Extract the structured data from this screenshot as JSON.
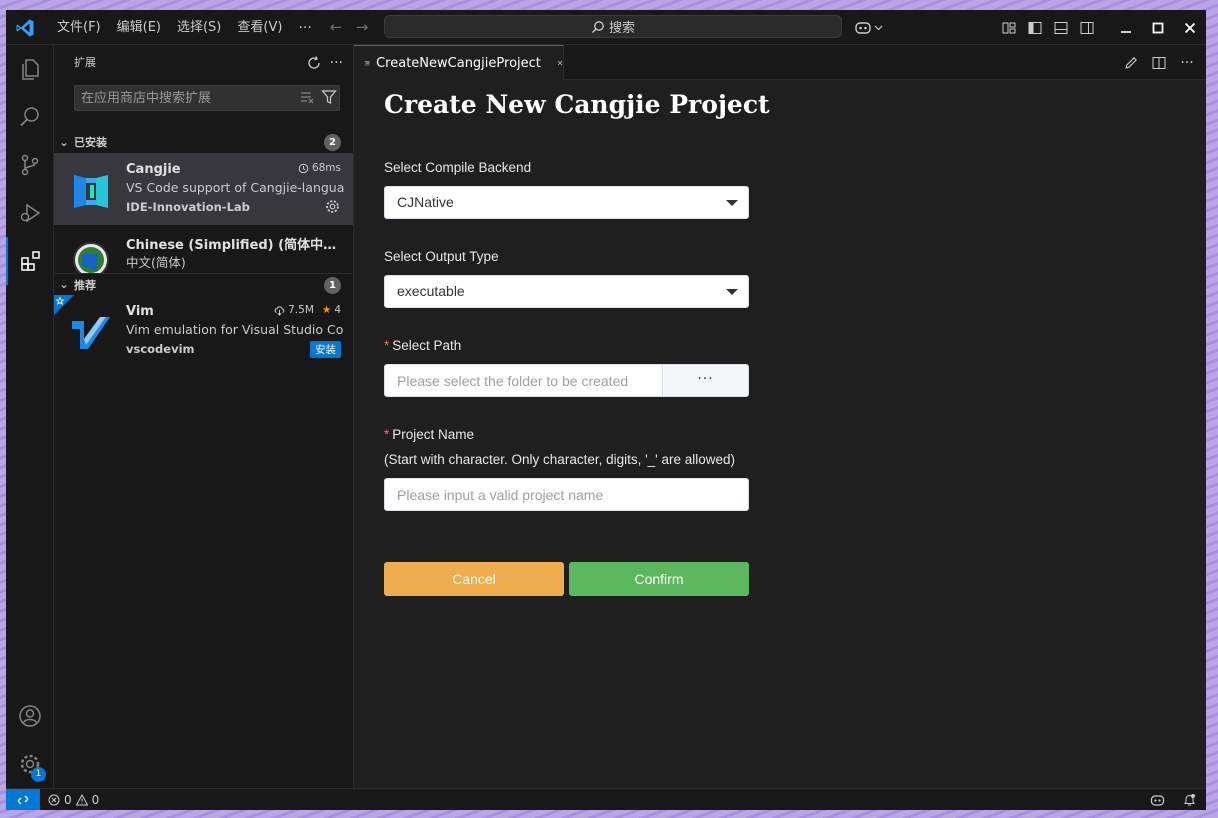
{
  "menu": {
    "file": "文件(F)",
    "edit": "编辑(E)",
    "selection": "选择(S)",
    "view": "查看(V)",
    "more": "···"
  },
  "command_center": {
    "search_label": "搜索"
  },
  "sidebar": {
    "title": "扩展",
    "search_placeholder": "在应用商店中搜索扩展",
    "installed": {
      "label": "已安装",
      "count": "2",
      "items": [
        {
          "name": "Cangjie",
          "meta": "68ms",
          "description": "VS Code support of Cangjie-language",
          "publisher": "IDE-Innovation-Lab"
        },
        {
          "name": "Chinese (Simplified) (简体中文) Language Pack for Visual Studio Code",
          "description": "中文(简体)"
        }
      ]
    },
    "recommended": {
      "label": "推荐",
      "count": "1",
      "items": [
        {
          "name": "Vim",
          "downloads": "7.5M",
          "rating": "4",
          "description": "Vim emulation for Visual Studio Code",
          "publisher": "vscodevim",
          "install_label": "安装"
        }
      ]
    }
  },
  "activity": {
    "settings_badge": "1"
  },
  "editor": {
    "tab_label": "CreateNewCangjieProject"
  },
  "form": {
    "title": "Create New Cangjie Project",
    "backend_label": "Select Compile Backend",
    "backend_value": "CJNative",
    "output_label": "Select Output Type",
    "output_value": "executable",
    "path_required": "*",
    "path_label": "Select Path",
    "path_placeholder": "Please select the folder to be created",
    "path_browse": "···",
    "name_required": "*",
    "name_label": "Project Name",
    "name_hint": "(Start with character. Only character, digits, '_' are allowed)",
    "name_placeholder": "Please input a valid project name",
    "cancel_label": "Cancel",
    "confirm_label": "Confirm"
  },
  "statusbar": {
    "errors": "0",
    "warnings": "0"
  },
  "colors": {
    "accent": "#0078d4",
    "cancel": "#f0ad4e",
    "confirm": "#5cb85c",
    "required": "#f56c6c"
  }
}
